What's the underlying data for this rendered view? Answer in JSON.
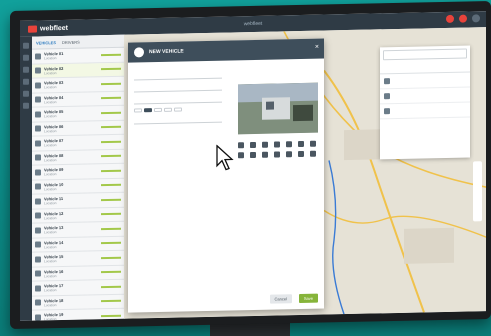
{
  "app": {
    "logo_text": "webfleet",
    "window_title": "webfleet"
  },
  "sidebar": {
    "tabs": [
      "VEHICLES",
      "DRIVERS"
    ],
    "active_tab": 0,
    "items": [
      {
        "name": "Vehicle 01",
        "sub": "Location"
      },
      {
        "name": "Vehicle 02",
        "sub": "Location"
      },
      {
        "name": "Vehicle 03",
        "sub": "Location"
      },
      {
        "name": "Vehicle 04",
        "sub": "Location"
      },
      {
        "name": "Vehicle 05",
        "sub": "Location"
      },
      {
        "name": "Vehicle 06",
        "sub": "Location"
      },
      {
        "name": "Vehicle 07",
        "sub": "Location"
      },
      {
        "name": "Vehicle 08",
        "sub": "Location"
      },
      {
        "name": "Vehicle 09",
        "sub": "Location"
      },
      {
        "name": "Vehicle 10",
        "sub": "Location"
      },
      {
        "name": "Vehicle 11",
        "sub": "Location"
      },
      {
        "name": "Vehicle 12",
        "sub": "Location"
      },
      {
        "name": "Vehicle 13",
        "sub": "Location"
      },
      {
        "name": "Vehicle 14",
        "sub": "Location"
      },
      {
        "name": "Vehicle 15",
        "sub": "Location"
      },
      {
        "name": "Vehicle 16",
        "sub": "Location"
      },
      {
        "name": "Vehicle 17",
        "sub": "Location"
      },
      {
        "name": "Vehicle 18",
        "sub": "Location"
      },
      {
        "name": "Vehicle 19",
        "sub": "Location"
      }
    ]
  },
  "modal": {
    "title": "NEW VEHICLE",
    "subtitle": "",
    "fields": [
      {
        "label": "",
        "value": ""
      },
      {
        "label": "",
        "value": ""
      },
      {
        "label": "",
        "value": ""
      },
      {
        "label": "",
        "value": ""
      }
    ],
    "segments": [
      "",
      "",
      "",
      "",
      ""
    ],
    "photo_label": "",
    "cancel_label": "Cancel",
    "save_label": "Save"
  },
  "right_panel": {
    "tabs": [
      "",
      ""
    ],
    "rows": [
      "",
      "",
      ""
    ]
  },
  "colors": {
    "brand": "#e8433b",
    "accent_green": "#86b43a",
    "header_dark": "#2f3b45"
  }
}
